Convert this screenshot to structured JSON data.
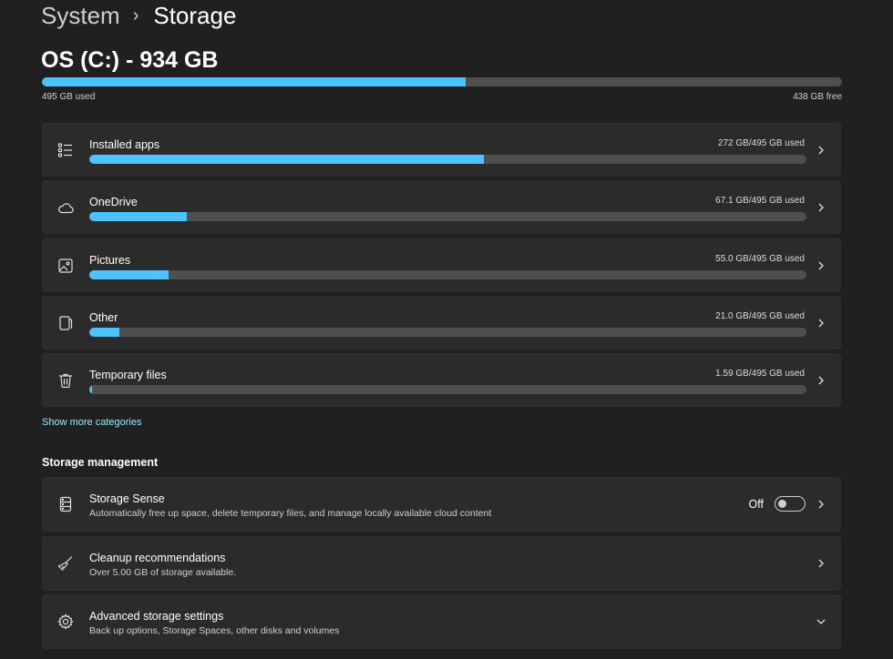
{
  "breadcrumb": {
    "parent": "System",
    "separator": "›",
    "current": "Storage"
  },
  "drive": {
    "title": "OS (C:) - 934 GB",
    "used_label": "495 GB used",
    "free_label": "438 GB free",
    "used_fraction": 0.53
  },
  "categories": [
    {
      "label": "Installed apps",
      "size": "272 GB/495 GB used",
      "fraction": 0.55,
      "icon": "apps-list-icon"
    },
    {
      "label": "OneDrive",
      "size": "67.1 GB/495 GB used",
      "fraction": 0.136,
      "icon": "cloud-icon"
    },
    {
      "label": "Pictures",
      "size": "55.0 GB/495 GB used",
      "fraction": 0.111,
      "icon": "picture-icon"
    },
    {
      "label": "Other",
      "size": "21.0 GB/495 GB used",
      "fraction": 0.042,
      "icon": "document-icon"
    },
    {
      "label": "Temporary files",
      "size": "1.59 GB/495 GB used",
      "fraction": 0.003,
      "icon": "trash-icon"
    }
  ],
  "show_more": "Show more categories",
  "management": {
    "heading": "Storage management",
    "items": [
      {
        "title": "Storage Sense",
        "subtitle": "Automatically free up space, delete temporary files, and manage locally available cloud content",
        "toggle_label": "Off",
        "icon": "storage-sense-icon"
      },
      {
        "title": "Cleanup recommendations",
        "subtitle": "Over 5.00 GB of storage available.",
        "icon": "broom-icon"
      },
      {
        "title": "Advanced storage settings",
        "subtitle": "Back up options, Storage Spaces, other disks and volumes",
        "icon": "gear-icon"
      }
    ]
  },
  "colors": {
    "accent": "#4cc2ff",
    "track": "#4f4f4f",
    "card": "#2b2b2b",
    "background": "#202020",
    "link": "#99ebff"
  }
}
